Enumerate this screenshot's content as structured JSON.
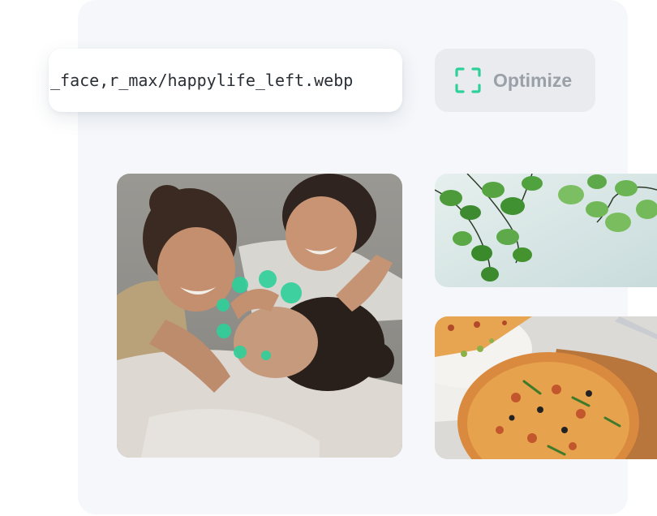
{
  "url_field": {
    "value": "_face,r_max/happylife_left.webp"
  },
  "optimize_button": {
    "label": "Optimize",
    "icon": "scan-frame-icon"
  },
  "colors": {
    "accent": "#2ed09a",
    "panel_background": "#f5f7fa",
    "button_background": "#e9ebee",
    "button_text": "#9aa0a8"
  },
  "images": {
    "main": {
      "subject": "three smiling women lying together",
      "overlay": "face-detection dots"
    },
    "top_right": {
      "subject": "green leaves"
    },
    "bottom_right": {
      "subject": "pizza"
    }
  }
}
